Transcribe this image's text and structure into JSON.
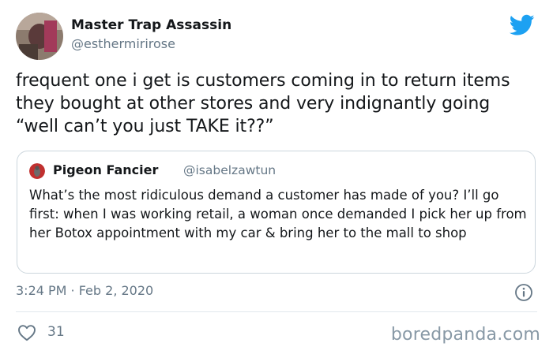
{
  "tweet": {
    "author_name": "Master Trap Assassin",
    "author_handle": "@esthermirirose",
    "text": "frequent one i get is customers coming in to return items they bought at other stores and very indignantly going “well can’t you just TAKE it??”",
    "timestamp": "3:24 PM · Feb 2, 2020",
    "like_count": "31"
  },
  "quoted_tweet": {
    "author_name": "Pigeon Fancier",
    "author_handle": "@isabelzawtun",
    "text": "What’s the most ridiculous demand a customer has made of you? I’ll go first: when I was working retail, a woman once demanded I pick her up from her Botox appointment with my car & bring her to the mall to shop"
  },
  "watermark": "boredpanda.com",
  "icons": {
    "brand": "twitter-bird-icon",
    "info": "info-icon",
    "like": "heart-icon"
  },
  "colors": {
    "twitter_blue": "#1da1f2",
    "text_primary": "#14171a",
    "text_secondary": "#657786",
    "border": "#ccd6dd"
  }
}
